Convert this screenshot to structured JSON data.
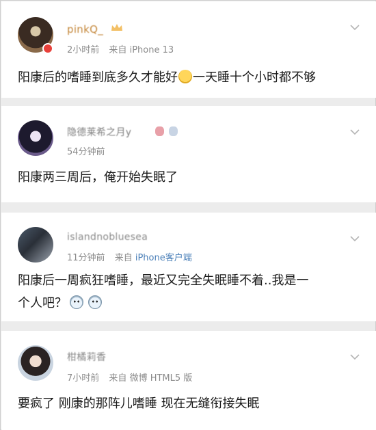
{
  "comments": [
    {
      "username": "pinkQ_",
      "time": "2小时前",
      "source_prefix": "来自",
      "client": "iPhone 13",
      "text_before_emoji": "阳康后的嗜睡到底多久才能好",
      "emoji": "smirk-emoji",
      "text_after_emoji": "一天睡十个小时都不够"
    },
    {
      "username": "隐德莱希之月y",
      "time": "54分钟前",
      "text": "阳康两三周后，俺开始失眠了"
    },
    {
      "username": "islandnobluesea",
      "time": "11分钟前",
      "source_prefix": "来自",
      "client": "iPhone客户端",
      "text_line1": "阳康后一周疯狂嗜睡，最近又完全失眠睡不着..我是一",
      "text_line2": "个人吧？",
      "emoji": "crying-face-emoji"
    },
    {
      "username": "柑橘莉香",
      "time": "7小时前",
      "source_prefix": "来自",
      "client": "微博 HTML5 版",
      "text": "要疯了 刚康的那阵儿嗜睡 现在无缝衔接失眠"
    }
  ],
  "colors": {
    "vip_name": "#c4873a",
    "link": "#4a7fb8",
    "meta": "#8a8a8a",
    "text": "#1a1a1a"
  }
}
